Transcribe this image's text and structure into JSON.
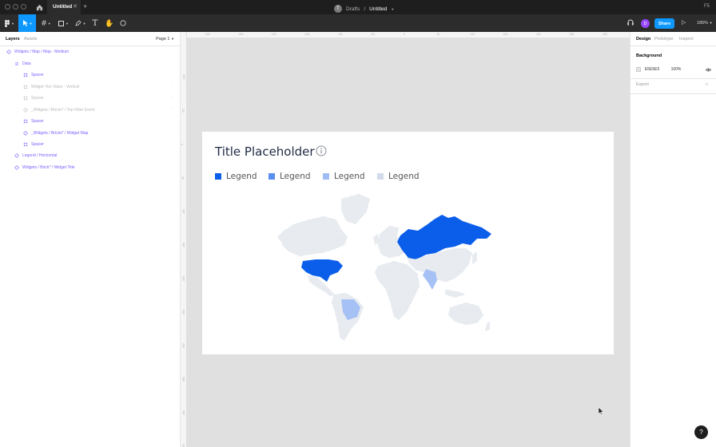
{
  "window": {
    "tab_title": "Untitled",
    "right_initials": "F5"
  },
  "toolbar": {
    "location": "Drafts",
    "file_name": "Untitled",
    "location_avatar": "T",
    "user_initial": "D",
    "share_label": "Share",
    "zoom": "185%"
  },
  "left_panel": {
    "tabs": [
      "Layers",
      "Assets"
    ],
    "page": "Page 1",
    "layers": [
      {
        "label": "Widgets / Map / Map - Medium",
        "dim": false
      },
      {
        "label": "Data",
        "dim": false
      },
      {
        "label": "Spacer",
        "dim": false
      },
      {
        "label": "Widget: Kei Value - Vertical",
        "dim": true
      },
      {
        "label": "Spacer",
        "dim": true
      },
      {
        "label": "_Widgets / Bricks* / Top Filter Event",
        "dim": true
      },
      {
        "label": "Spacer",
        "dim": false
      },
      {
        "label": "_Widgets / Bricks* / Widget Map",
        "dim": false
      },
      {
        "label": "Spacer",
        "dim": false
      },
      {
        "label": "Legend / Horizontal",
        "dim": false
      },
      {
        "label": "Widgets / Brick* / Widget Title",
        "dim": false
      }
    ]
  },
  "canvas": {
    "ruler_top": [
      "-300",
      "-250",
      "-200",
      "-150",
      "-100",
      "-50",
      "0",
      "50",
      "100",
      "150",
      "200",
      "250",
      "300"
    ],
    "ruler_left": [
      "-100",
      "-50",
      "0",
      "50",
      "100",
      "150",
      "200",
      "250",
      "300",
      "350",
      "400",
      "450"
    ],
    "widget": {
      "title": "Title Placeholder",
      "legend": [
        {
          "label": "Legend",
          "color": "#0a5eea"
        },
        {
          "label": "Legend",
          "color": "#5b8ff0"
        },
        {
          "label": "Legend",
          "color": "#9fbcf5"
        },
        {
          "label": "Legend",
          "color": "#d2dbea"
        }
      ],
      "map_colors": {
        "land": "#d0d6e0",
        "highlight_strong": "#0a5eea",
        "highlight_light": "#9fbcf5"
      }
    }
  },
  "right_panel": {
    "tabs": [
      "Design",
      "Prototype",
      "Inspect"
    ],
    "background_label": "Background",
    "bg_hex": "E5E5E5",
    "bg_opacity": "100%",
    "export_label": "Export"
  },
  "help_label": "?"
}
